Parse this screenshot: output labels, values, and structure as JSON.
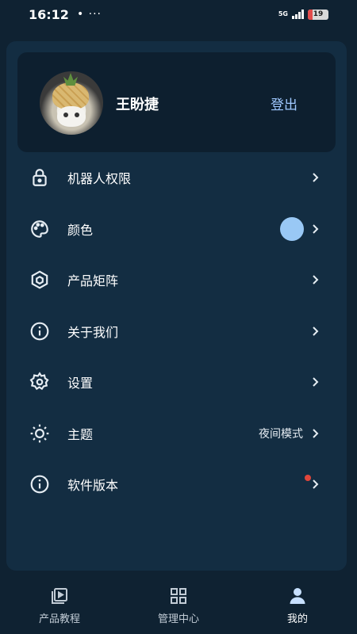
{
  "status_bar": {
    "time": "16:12",
    "dots": "• ···",
    "network": "5G",
    "battery": "19"
  },
  "profile": {
    "username": "王盼捷",
    "logout_label": "登出"
  },
  "menu": {
    "items": [
      {
        "label": "机器人权限",
        "icon": "lock-icon"
      },
      {
        "label": "颜色",
        "icon": "palette-icon",
        "swatch_color": "#99c8f5"
      },
      {
        "label": "产品矩阵",
        "icon": "hexagon-cube-icon"
      },
      {
        "label": "关于我们",
        "icon": "info-icon"
      },
      {
        "label": "设置",
        "icon": "gear-icon"
      },
      {
        "label": "主题",
        "icon": "sun-icon",
        "value": "夜间模式"
      },
      {
        "label": "软件版本",
        "icon": "info-icon",
        "badge_color": "#e0463b"
      }
    ]
  },
  "bottom_nav": {
    "tabs": [
      {
        "label": "产品教程",
        "icon": "play-library-icon",
        "active": false
      },
      {
        "label": "管理中心",
        "icon": "grid-icon",
        "active": false
      },
      {
        "label": "我的",
        "icon": "person-icon",
        "active": true
      }
    ]
  },
  "colors": {
    "background": "#0f2232",
    "panel": "#132d42",
    "card": "#0d1f2f",
    "accent": "#9fc8ff",
    "active_tab": "#c7e0ff"
  }
}
